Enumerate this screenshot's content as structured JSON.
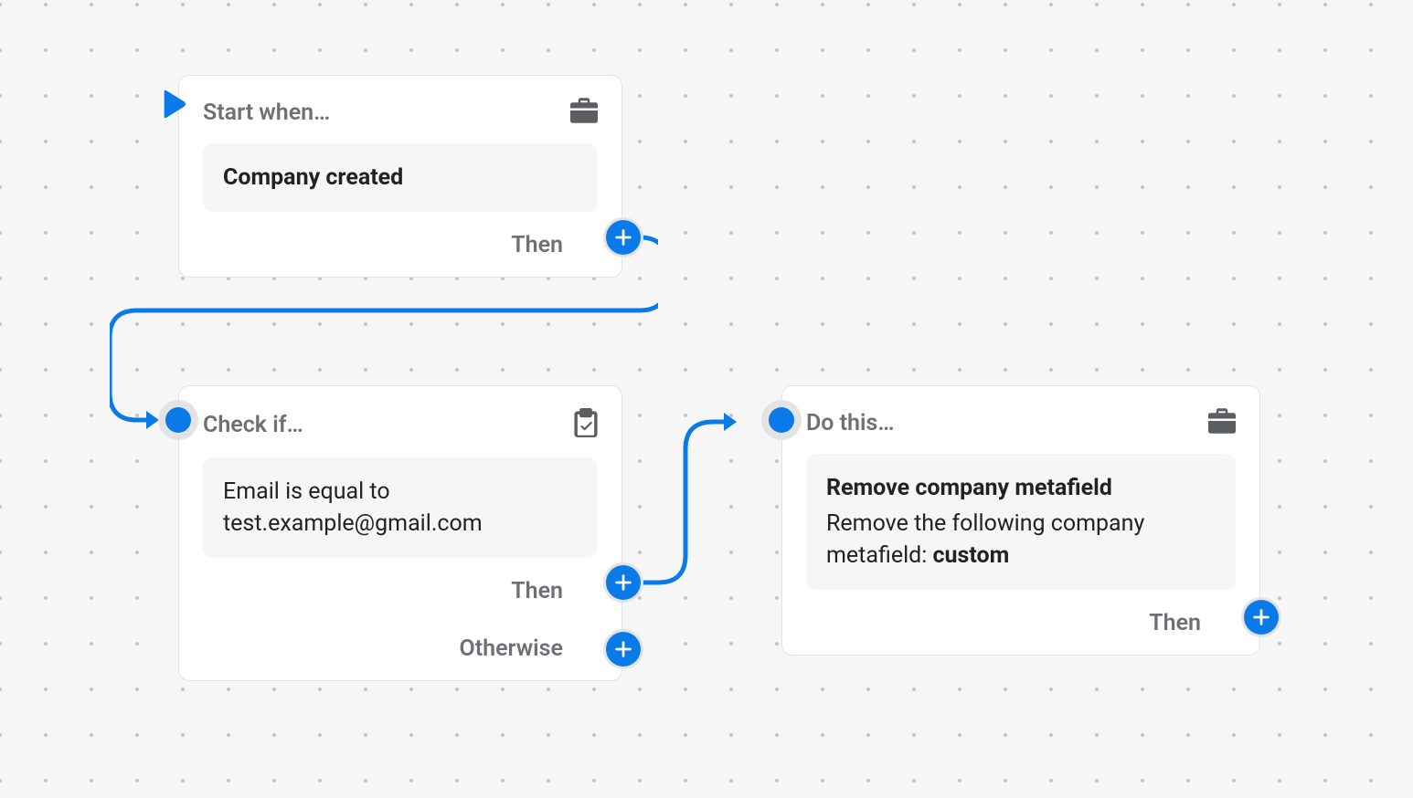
{
  "nodes": {
    "trigger": {
      "header": "Start when…",
      "body": "Company created",
      "then_label": "Then"
    },
    "condition": {
      "header": "Check if…",
      "body": "Email is equal to test.example@gmail.com",
      "then_label": "Then",
      "otherwise_label": "Otherwise"
    },
    "action": {
      "header": "Do this…",
      "body_title": "Remove company metafield",
      "body_desc_prefix": "Remove the following company metafield: ",
      "body_desc_bold": "custom",
      "then_label": "Then"
    }
  }
}
